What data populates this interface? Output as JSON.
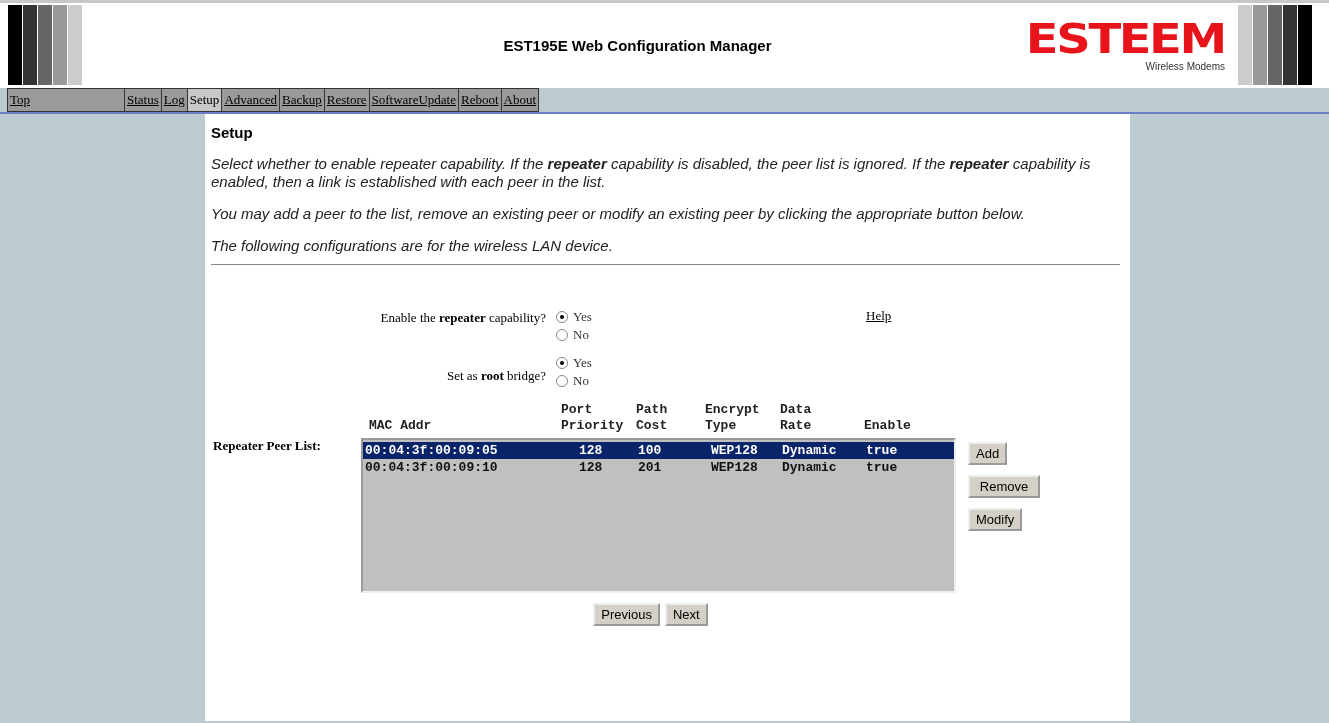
{
  "header": {
    "title": "EST195E Web Configuration Manager",
    "logo": {
      "name": "ESTEEM",
      "tagline": "Wireless Modems"
    }
  },
  "nav": [
    {
      "label": "Top",
      "selected": false
    },
    {
      "label": "Status",
      "selected": false
    },
    {
      "label": "Log",
      "selected": false
    },
    {
      "label": "Setup",
      "selected": true
    },
    {
      "label": "Advanced",
      "selected": false
    },
    {
      "label": "Backup",
      "selected": false
    },
    {
      "label": "Restore",
      "selected": false
    },
    {
      "label": "SoftwareUpdate",
      "selected": false
    },
    {
      "label": "Reboot",
      "selected": false
    },
    {
      "label": "About",
      "selected": false
    }
  ],
  "section_title": "Setup",
  "paragraphs": [
    "Select whether to enable repeater capability. If the **repeater** capability is disabled, the peer list is ignored. If the **repeater** capability is enabled, then a link is established with each peer in the list.",
    "You may add a peer to the list, remove an existing peer or modify an existing peer by clicking the appropriate button below.",
    "The following configurations are for the wireless LAN device."
  ],
  "help_link": "Help",
  "fields": [
    {
      "label": "Enable the **repeater** capability?",
      "options": [
        {
          "label": "Yes",
          "selected": true
        },
        {
          "label": "No",
          "selected": false
        }
      ]
    },
    {
      "label": "Set as **root** bridge?",
      "options": [
        {
          "label": "Yes",
          "selected": true
        },
        {
          "label": "No",
          "selected": false
        }
      ]
    }
  ],
  "peer_list": {
    "label": "Repeater Peer List:",
    "columns": [
      "MAC Addr",
      "Port Priority",
      "Path Cost",
      "Encrypt Type",
      "Data Rate",
      "Enable"
    ],
    "rows": [
      {
        "cells": [
          "00:04:3f:00:09:05",
          "128",
          "100",
          "WEP128",
          "Dynamic",
          "true"
        ],
        "selected": true
      },
      {
        "cells": [
          "00:04:3f:00:09:10",
          "128",
          "201",
          "WEP128",
          "Dynamic",
          "true"
        ],
        "selected": false
      }
    ]
  },
  "side_buttons": [
    "Add",
    "Remove",
    "Modify"
  ],
  "nav_buttons": [
    "Previous",
    "Next"
  ]
}
